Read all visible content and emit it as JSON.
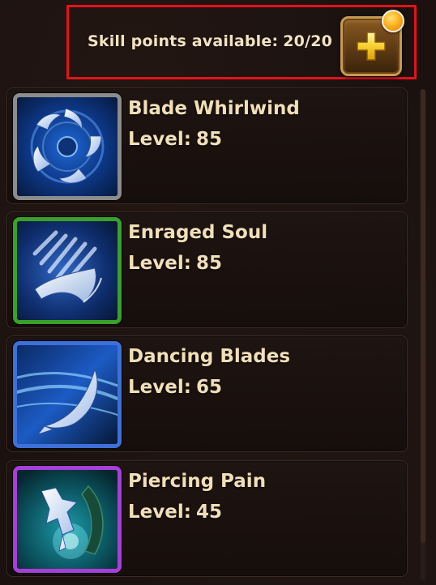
{
  "header": {
    "skill_points_label": "Skill points available:",
    "skill_points_value": "20/20",
    "add_button_icon": "plus-icon",
    "notification_icon": "notification-dot-icon",
    "accent_color": "#e4121b"
  },
  "skills": [
    {
      "name": "Blade Whirlwind",
      "level_label": "Level:",
      "level_value": "85",
      "icon": "blade-whirlwind-icon",
      "frame_color": "#8c8c8c"
    },
    {
      "name": "Enraged Soul",
      "level_label": "Level:",
      "level_value": "85",
      "icon": "enraged-soul-icon",
      "frame_color": "#3aa02a"
    },
    {
      "name": "Dancing Blades",
      "level_label": "Level:",
      "level_value": "65",
      "icon": "dancing-blades-icon",
      "frame_color": "#3f6fd8"
    },
    {
      "name": "Piercing Pain",
      "level_label": "Level:",
      "level_value": "45",
      "icon": "piercing-pain-icon",
      "frame_color": "#a63fd8"
    }
  ]
}
